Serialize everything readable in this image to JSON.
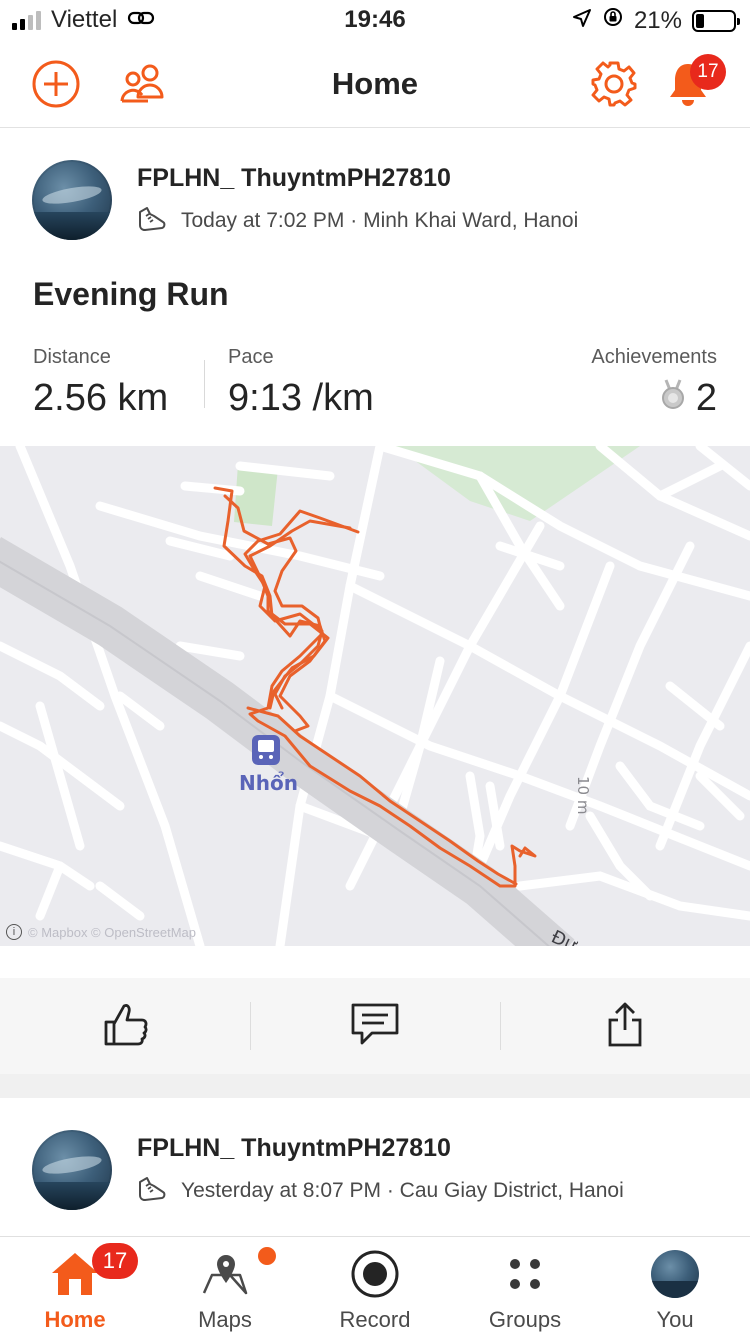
{
  "status_bar": {
    "carrier": "Viettel",
    "time": "19:46",
    "battery_percent": "21%",
    "battery_level": 0.21,
    "icons": [
      "signal-icon",
      "link-icon",
      "location-arrow-icon",
      "rotation-lock-icon",
      "battery-icon"
    ]
  },
  "header": {
    "title": "Home",
    "icons": [
      "add-circle-icon",
      "people-icon",
      "gear-icon",
      "bell-icon"
    ],
    "notification_count": "17"
  },
  "feed": [
    {
      "athlete": "FPLHN_ ThuyntmPH27810",
      "timestamp_location": "Today at 7:02 PM · Minh Khai Ward, Hanoi",
      "activity_icon": "running-shoe-icon",
      "title": "Evening Run",
      "stats": {
        "distance_label": "Distance",
        "distance_value": "2.56 km",
        "pace_label": "Pace",
        "pace_value": "9:13 /km",
        "achievements_label": "Achievements",
        "achievements_value": "2"
      },
      "map": {
        "station_label": "Nhổn",
        "road_label": "10 m",
        "edge_road_label": "Đư",
        "attribution": "© Mapbox © OpenStreetMap",
        "route_color": "#e8612c"
      },
      "actions": [
        "thumbs-up-icon",
        "comment-icon",
        "share-icon"
      ]
    },
    {
      "athlete": "FPLHN_ ThuyntmPH27810",
      "timestamp_location": "Yesterday at 8:07 PM · Cau Giay District, Hanoi",
      "activity_icon": "running-shoe-icon"
    }
  ],
  "tab_bar": {
    "tabs": [
      {
        "label": "Home",
        "icon": "home-icon",
        "active": true,
        "badge": "17"
      },
      {
        "label": "Maps",
        "icon": "map-pin-icon",
        "dot": true
      },
      {
        "label": "Record",
        "icon": "record-icon"
      },
      {
        "label": "Groups",
        "icon": "groups-dots-icon"
      },
      {
        "label": "You",
        "icon": "avatar"
      }
    ]
  },
  "colors": {
    "brand_orange": "#f35b1b",
    "badge_red": "#e8291c",
    "text_dark": "#242424"
  }
}
